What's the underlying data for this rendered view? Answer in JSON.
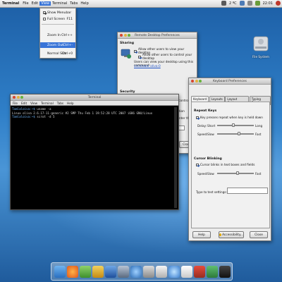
{
  "menubar": {
    "app_title": "Terminal",
    "menus": [
      "File",
      "Edit",
      "View",
      "Terminal",
      "Tabs",
      "Help"
    ],
    "active_menu": "View",
    "tray_text": "2 ºC",
    "clock": "22:01"
  },
  "view_menu": {
    "items": [
      {
        "label": "Show Menubar",
        "checked": true,
        "shortcut": ""
      },
      {
        "label": "Full Screen",
        "checked": false,
        "shortcut": "F11"
      },
      {
        "label": "Zoom In",
        "shortcut": "Ctrl++"
      },
      {
        "label": "Zoom Out",
        "shortcut": "Ctrl+-"
      },
      {
        "label": "Normal Size",
        "shortcut": "Ctrl+0"
      }
    ],
    "highlighted": "Zoom Out"
  },
  "desktop": {
    "hd_label": "File System"
  },
  "remote_desktop": {
    "title": "Remote Desktop Preferences",
    "sharing_heading": "Sharing",
    "allow_view_label": "Allow other users to view your desktop",
    "allow_view_checked": true,
    "allow_control_label": "Allow other users to control your desktop",
    "allow_control_checked": true,
    "command_text": "Users can view your desktop using this command:",
    "command_link": "vncviewer oliva:0",
    "security_heading": "Security",
    "ask_label": "...ter tries to view or control your desktop",
    "confirm_label": "...sk you for confirmation",
    "require_password_label": "...quire the user to enter this password:",
    "require_password_checked": true,
    "password_label": "Password:",
    "password_value": "••••••••",
    "help_button": "Help",
    "close_button": "Close"
  },
  "keyboard": {
    "title": "Keyboard Preferences",
    "tabs": [
      "Keyboard",
      "Layouts",
      "Layout Options",
      "Typing Break"
    ],
    "active_tab": "Keyboard",
    "repeat_heading": "Repeat Keys",
    "repeat_label": "Key presses repeat when key is held down",
    "repeat_checked": true,
    "delay_label": "Delay:",
    "delay_short": "Short",
    "delay_long": "Long",
    "delay_value": 0.45,
    "speed_label": "Speed:",
    "speed_slow": "Slow",
    "speed_fast": "Fast",
    "repeat_speed_value": 0.6,
    "cursor_heading": "Cursor Blinking",
    "cursor_label": "Cursor blinks in text boxes and fields",
    "cursor_checked": true,
    "cursor_speed_label": "Speed:",
    "cursor_speed_value": 0.55,
    "test_label": "Type to test settings:",
    "help_button": "Help",
    "accessibility_button": "Accessibility...",
    "close_button": "Close"
  },
  "terminal": {
    "title": "Terminal",
    "menus": [
      "File",
      "Edit",
      "View",
      "Terminal",
      "Tabs",
      "Help"
    ],
    "lines": [
      {
        "prompt": "Tamlaloiva:~$",
        "cmd": " uname -a"
      },
      {
        "prompt": "",
        "cmd": "Linux oliva 2.6.17-11-generic #2 SMP Thu Feb 1 19:52:28 UTC 2007 i686 GNU/Linux"
      },
      {
        "prompt": "Tamlaloiva:~$",
        "cmd": " scrot -d 5"
      }
    ]
  }
}
